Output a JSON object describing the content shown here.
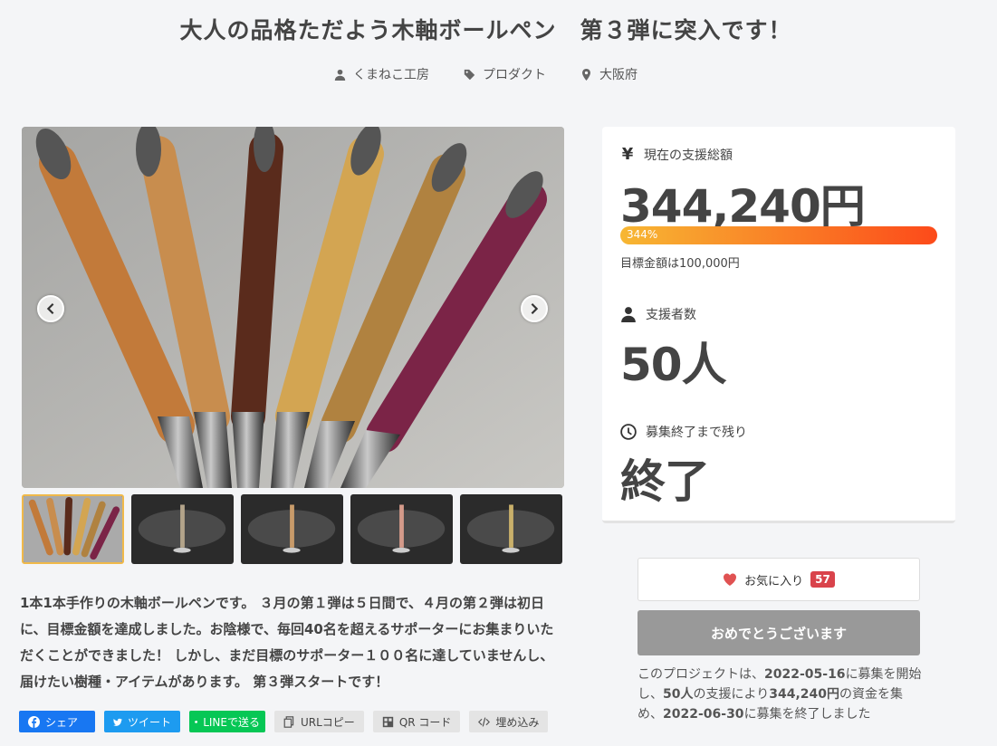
{
  "project": {
    "title": "大人の品格ただよう木軸ボールペン　第３弾に突入です！",
    "owner": "くまねこ工房",
    "category": "プロダクト",
    "location": "大阪府"
  },
  "icons": {
    "owner": "user-icon",
    "category": "tag-icon",
    "location": "map-pin-icon",
    "prev": "chevron-left-icon",
    "next": "chevron-right-icon",
    "yen": "yen-icon",
    "supporters": "user-icon",
    "time": "clock-icon",
    "favorite": "heart-icon"
  },
  "gallery": {
    "thumb_count": 5,
    "active_index": 0
  },
  "description": "1本1本手作りの木軸ボールペンです。 ３月の第１弾は５日間で、４月の第２弾は初日に、目標金額を達成しました。お陰様で、毎回40名を超えるサポーターにお集まりいただくことができました！ しかし、まだ目標のサポーター１００名に達していませんし、届けたい樹種・アイテムがあります。 第３弾スタートです！",
  "share": {
    "facebook": "シェア",
    "twitter": "ツイート",
    "line": "LINEで送る",
    "copy_url": "URLコピー",
    "qr": "QR コード",
    "embed": "埋め込み"
  },
  "stats": {
    "total_label": "現在の支援総額",
    "total_value": "344,240円",
    "progress_text": "344%",
    "progress_percent": 344,
    "goal_text": "目標金額は100,000円",
    "supporters_label": "支援者数",
    "supporters_value": "50人",
    "remaining_label": "募集終了まで残り",
    "remaining_value": "終了",
    "yen_symbol": "¥"
  },
  "actions": {
    "favorite_label": "お気に入り",
    "favorite_count": "57",
    "congrats_label": "おめでとうございます"
  },
  "summary": {
    "p1": "このプロジェクトは、",
    "start_date": "2022-05-16",
    "p2": "に募集を開始し、",
    "supporters": "50人",
    "p3": "の支援により",
    "amount": "344,240円",
    "p4": "の資金を集め、",
    "end_date": "2022-06-30",
    "p5": "に募集を終了しました"
  },
  "colors": {
    "progress_start": "#f7b733",
    "progress_end": "#fc4a1a",
    "badge": "#d9434b",
    "congrats_bg": "#999999",
    "thumb_active": "#f0b94a"
  }
}
